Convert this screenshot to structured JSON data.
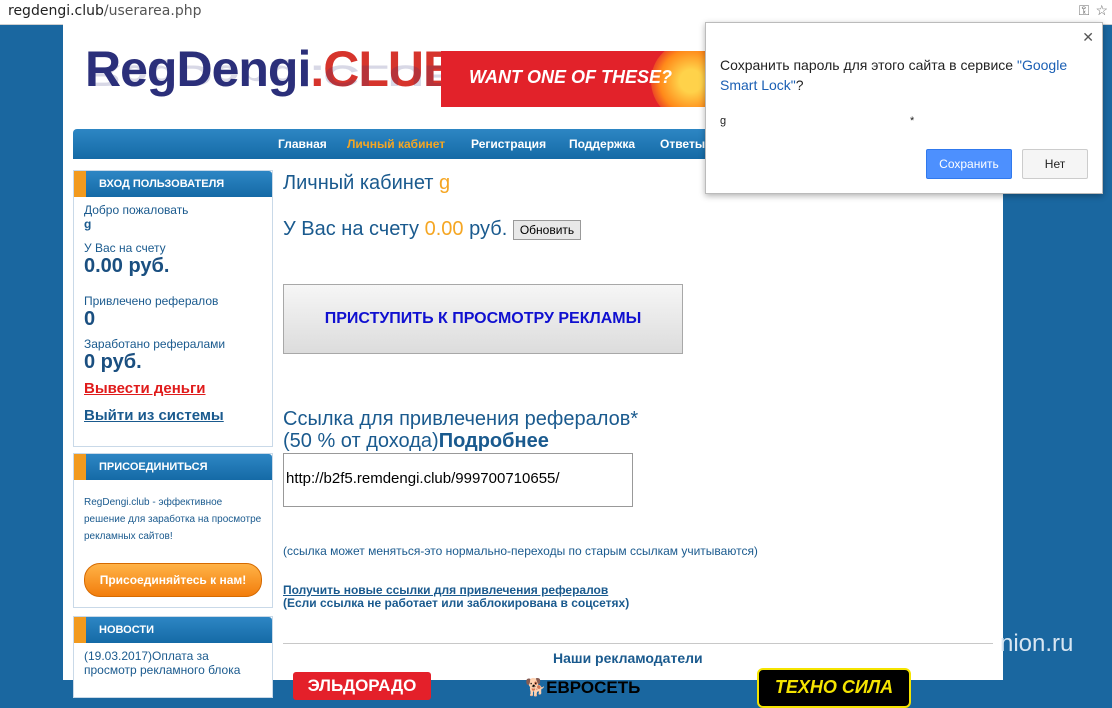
{
  "browser": {
    "url_host": "regdengi.club",
    "url_path": "/userarea.php"
  },
  "logo": {
    "main": "RegDengi",
    "suffix": ".CLUB"
  },
  "banner": {
    "text": "WANT ONE OF THESE?"
  },
  "nav": [
    "Главная",
    "Личный кабинет",
    "Регистрация",
    "Поддержка",
    "Ответы"
  ],
  "sidebar": {
    "login": {
      "title": "ВХОД ПОЛЬЗОВАТЕЛЯ",
      "welcome": "Добро пожаловать",
      "username": "g",
      "balance_label": "У Вас на счету",
      "balance": "0.00 руб.",
      "referrals_label": "Привлечено рефералов",
      "referrals": "0",
      "earned_label": "Заработано рефералами",
      "earned": "0 руб.",
      "withdraw": "Вывести деньги",
      "logout": "Выйти из системы"
    },
    "join": {
      "title": "ПРИСОЕДИНИТЬСЯ",
      "text": "RegDengi.club - эффективное решение для заработка на просмотре рекламных сайтов!",
      "button": "Присоединяйтесь к нам!"
    },
    "news": {
      "title": "НОВОСТИ",
      "item": "(19.03.2017)Оплата за просмотр рекламного блока"
    }
  },
  "main": {
    "cabinet_title": "Личный кабинет",
    "username": "g",
    "balance_prefix": "У Вас на счету",
    "balance_value": "0.00",
    "balance_suffix": "руб.",
    "refresh_button": "Обновить",
    "start_ads_button": "ПРИСТУПИТЬ К ПРОСМОТРУ РЕКЛАМЫ",
    "ref_title": "Ссылка для привлечения рефералов*",
    "ref_percent": "(50 % от дохода)",
    "ref_more": "Подробнее",
    "ref_link": "http://b2f5.remdengi.club/999700710655/",
    "ref_note": "(ссылка может меняться-это нормально-переходы по старым ссылкам учитываются)",
    "new_links": "Получить новые ссылки для привлечения рефералов",
    "new_links_note": "(Если ссылка не работает или заблокирована в соцсетях)",
    "advertisers_title": "Наши рекламодатели",
    "advertisers": [
      "ЭЛЬДОРАДО",
      "ЕВРОСЕТЬ",
      "ТЕХНО СИЛА"
    ]
  },
  "popup": {
    "message": "Сохранить пароль для этого сайта в сервисе",
    "link": "\"Google Smart Lock\"",
    "qmark": "?",
    "user": "g",
    "password_mask": "*",
    "save": "Сохранить",
    "no": "Нет"
  },
  "watermark": "nion.ru",
  "colors": {
    "accent_orange": "#f5a623",
    "nav_blue": "#156aa6",
    "link_red": "#e01b1b"
  }
}
